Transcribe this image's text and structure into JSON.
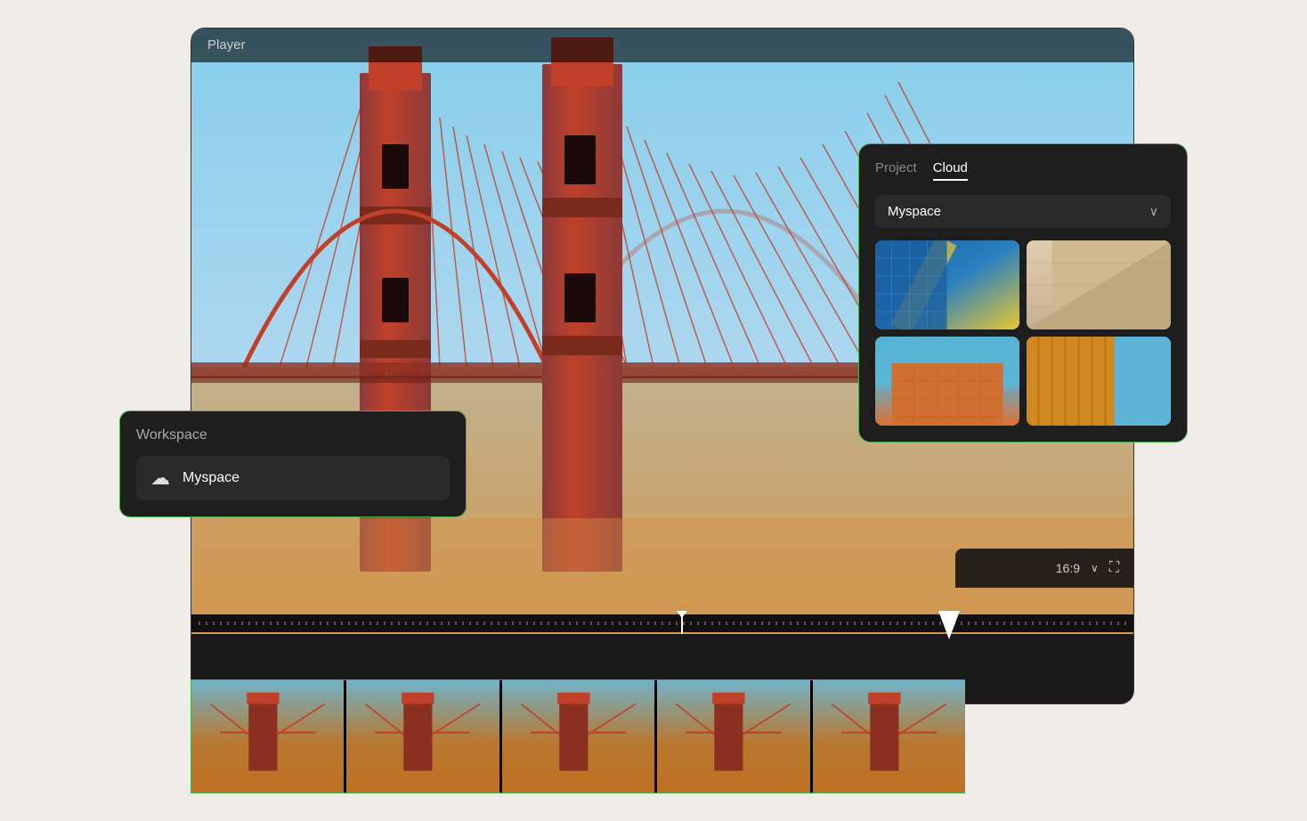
{
  "player": {
    "title": "Player",
    "aspect_ratio": "16:9",
    "fullscreen_label": "⛶"
  },
  "workspace": {
    "title": "Workspace",
    "item": {
      "label": "Myspace",
      "icon": "☁"
    }
  },
  "cloud_panel": {
    "tabs": [
      {
        "label": "Project",
        "active": false
      },
      {
        "label": "Cloud",
        "active": true
      }
    ],
    "dropdown": {
      "label": "Myspace",
      "arrow": "∨"
    },
    "thumbnails": [
      {
        "id": 1,
        "style_class": "thumb-geo-1"
      },
      {
        "id": 2,
        "style_class": "thumb-geo-2"
      },
      {
        "id": 3,
        "style_class": "thumb-geo-3"
      },
      {
        "id": 4,
        "style_class": "thumb-geo-4"
      }
    ]
  },
  "timeline": {
    "aspect_label": "16:9",
    "chevron": "∨"
  }
}
